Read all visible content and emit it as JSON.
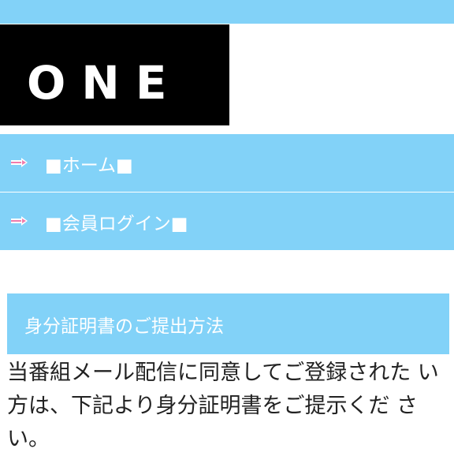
{
  "header": {
    "logo_text": "ONE"
  },
  "nav": {
    "items": [
      {
        "label": "■ホーム■",
        "icon": "arrow-right-icon"
      },
      {
        "label": "■会員ログイン■",
        "icon": "arrow-right-icon"
      }
    ]
  },
  "section": {
    "title": "身分証明書のご提出方法",
    "body": "当番組メール配信に同意してご登録された い方は、下記より身分証明書をご提示くだ さい。"
  },
  "colors": {
    "accent": "#82d2f8",
    "logo_bg": "#000000",
    "icon": "#f07cab"
  }
}
